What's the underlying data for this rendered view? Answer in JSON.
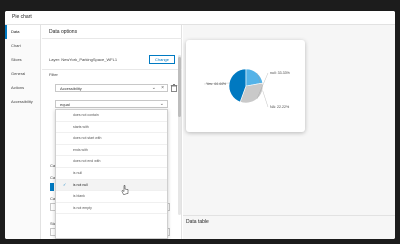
{
  "window": {
    "title": "Pie chart"
  },
  "tabs": [
    {
      "label": "Data",
      "active": true
    },
    {
      "label": "Chart",
      "active": false
    },
    {
      "label": "Slices",
      "active": false
    },
    {
      "label": "General",
      "active": false
    },
    {
      "label": "Actions",
      "active": false
    },
    {
      "label": "Accessibility",
      "active": false
    }
  ],
  "settings": {
    "heading": "Data options",
    "layer_text": "Layer: NewYork_ParkingSpace_WFL1",
    "change_label": "Change",
    "filter_label": "Filter",
    "field_value": "Accessibility",
    "operator_value": "equal",
    "dropdown_options": [
      {
        "label": "does not contain",
        "selected": false,
        "hover": false
      },
      {
        "label": "starts with",
        "selected": false,
        "hover": false
      },
      {
        "label": "does not start with",
        "selected": false,
        "hover": false
      },
      {
        "label": "ends with",
        "selected": false,
        "hover": false
      },
      {
        "label": "does not end with",
        "selected": false,
        "hover": false
      },
      {
        "label": "is null",
        "selected": false,
        "hover": false
      },
      {
        "label": "is not null",
        "selected": true,
        "hover": true
      },
      {
        "label": "is blank",
        "selected": false,
        "hover": false
      },
      {
        "label": "is not empty",
        "selected": false,
        "hover": false
      }
    ],
    "partial_labels": {
      "ca1": "Ca",
      "ca2": "Ca",
      "ca3": "Ca",
      "st": "Sta"
    },
    "count_value": "Count"
  },
  "preview": {
    "data_table_label": "Data table",
    "colors": {
      "slice1": "#0079c1",
      "slice2": "#54b3e8",
      "slice3": "#c9c9c9"
    },
    "labels": {
      "slice1": "Yes: 44.44%",
      "slice2": "NA: 22.22%",
      "slice3": "null: 33.33%"
    }
  },
  "chart_data": {
    "type": "pie",
    "categories": [
      "Yes",
      "NA",
      "null"
    ],
    "values": [
      44.44,
      22.22,
      33.33
    ]
  }
}
